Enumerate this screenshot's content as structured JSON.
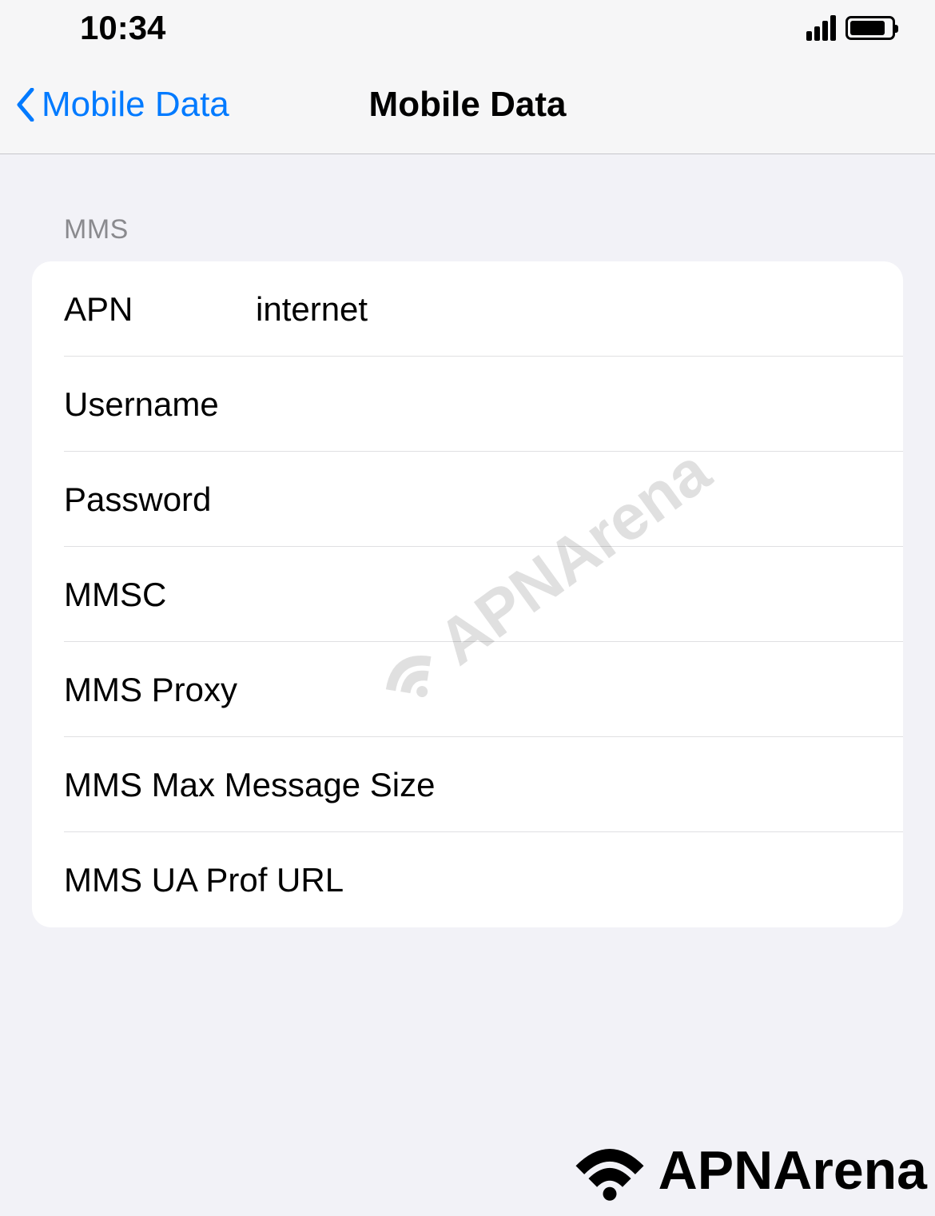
{
  "status_bar": {
    "time": "10:34"
  },
  "nav": {
    "back_label": "Mobile Data",
    "title": "Mobile Data"
  },
  "section_header": "MMS",
  "fields": {
    "apn": {
      "label": "APN",
      "value": "internet"
    },
    "username": {
      "label": "Username",
      "value": ""
    },
    "password": {
      "label": "Password",
      "value": ""
    },
    "mmsc": {
      "label": "MMSC",
      "value": ""
    },
    "mms_proxy": {
      "label": "MMS Proxy",
      "value": ""
    },
    "mms_max": {
      "label": "MMS Max Message Size",
      "value": ""
    },
    "mms_ua": {
      "label": "MMS UA Prof URL",
      "value": ""
    }
  },
  "watermark": {
    "text": "APNArena"
  }
}
